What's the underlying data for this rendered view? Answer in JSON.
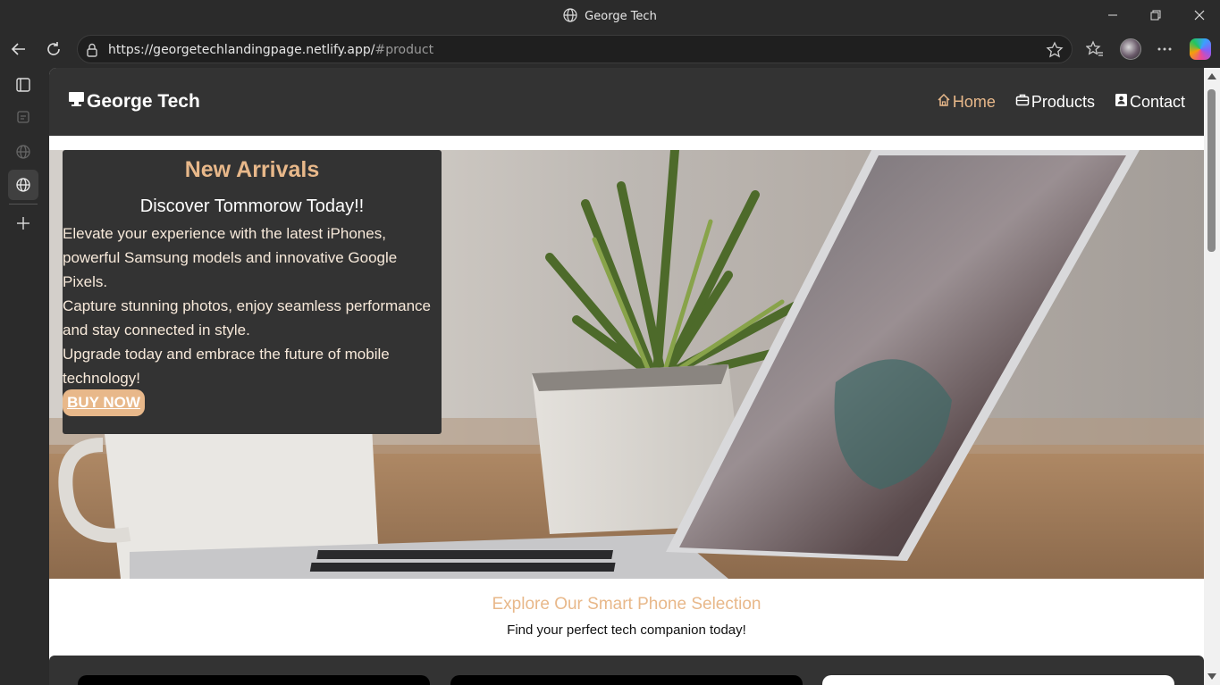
{
  "window": {
    "title": "George Tech"
  },
  "browser": {
    "url_host": "https://georgetechlandingpage.netlify.app/",
    "url_path": "#product"
  },
  "site": {
    "brand": "George Tech",
    "nav": [
      {
        "label": "Home",
        "active": true
      },
      {
        "label": "Products",
        "active": false
      },
      {
        "label": "Contact",
        "active": false
      }
    ]
  },
  "promo": {
    "heading": "New Arrivals",
    "subheading": "Discover Tommorow Today!!",
    "lines": [
      "Elevate your experience with the latest iPhones,",
      "powerful Samsung models and innovative Google",
      "Pixels.",
      "Capture stunning photos, enjoy seamless performance",
      "and stay connected in style.",
      "Upgrade today and embrace the future of mobile",
      "technology!"
    ],
    "button": "BUY NOW"
  },
  "explore": {
    "title": "Explore Our Smart Phone Selection",
    "subtitle": "Find your perfect tech companion today!"
  },
  "colors": {
    "accent": "#e8b88a",
    "header_bg": "#333333",
    "browser_bg": "#2b2b2b"
  }
}
